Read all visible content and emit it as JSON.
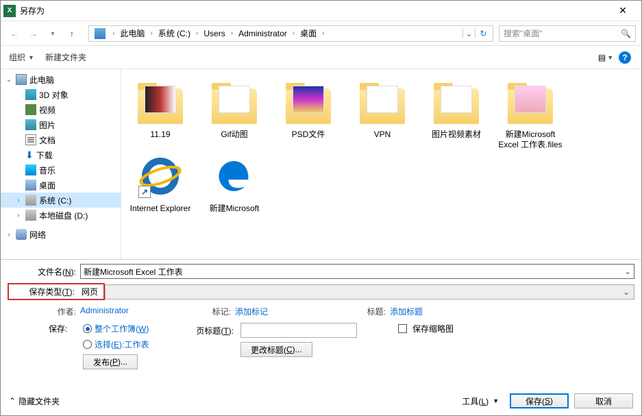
{
  "window": {
    "title": "另存为"
  },
  "nav": {
    "crumbs": [
      "此电脑",
      "系统 (C:)",
      "Users",
      "Administrator",
      "桌面"
    ],
    "search_placeholder": "搜索\"桌面\""
  },
  "toolbar": {
    "organize": "组织",
    "newfolder": "新建文件夹"
  },
  "sidebar": {
    "pc": "此电脑",
    "threed": "3D 对象",
    "video": "视频",
    "pictures": "图片",
    "docs": "文档",
    "downloads": "下载",
    "music": "音乐",
    "desktop": "桌面",
    "cdrive": "系统 (C:)",
    "ddrive": "本地磁盘 (D:)",
    "network": "网络"
  },
  "files": {
    "f1": "11.19",
    "f2": "Gif动图",
    "f3": "PSD文件",
    "f4": "VPN",
    "f5": "图片视频素材",
    "f6": "新建Microsoft Excel 工作表.files",
    "f7": "Internet Explorer",
    "f8": "新建Microsoft"
  },
  "fields": {
    "filename_label": "文件名(N):",
    "filename_value": "新建Microsoft Excel 工作表",
    "filetype_label": "保存类型(T):",
    "filetype_value": "网页",
    "author_label": "作者:",
    "author_value": "Administrator",
    "tags_label": "标记:",
    "tags_value": "添加标记",
    "titlef_label": "标题:",
    "titlef_value": "添加标题",
    "save_label": "保存:",
    "radio1": "整个工作簿(W)",
    "radio2": "选择(E):工作表",
    "publish_btn": "发布(P)...",
    "pagetitle_label": "页标题(T):",
    "change_title_btn": "更改标题(C)...",
    "thumb_cb": "保存缩略图"
  },
  "footer": {
    "hide": "隐藏文件夹",
    "tools": "工具(L)",
    "save": "保存(S)",
    "cancel": "取消"
  }
}
